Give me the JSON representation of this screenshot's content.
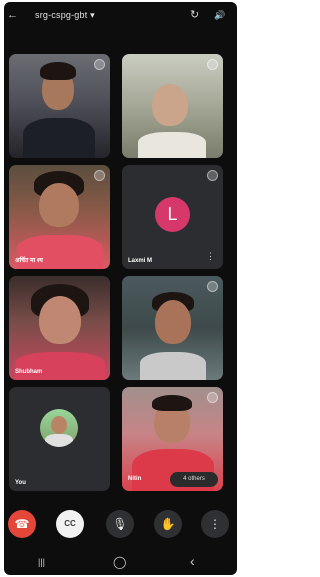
{
  "meeting": {
    "code": "srg-cspg-gbt",
    "chevron": "▾",
    "back_icon": "←",
    "switch_camera_icon": "↻",
    "speaker_icon": "🔊"
  },
  "participants": [
    {
      "name": "",
      "state": "video"
    },
    {
      "name": "",
      "state": "video"
    },
    {
      "name": "अर्चित मा श्य",
      "state": "video"
    },
    {
      "name": "Laxmi M",
      "state": "avatar",
      "initial": "L"
    },
    {
      "name": "Shubham",
      "state": "video"
    },
    {
      "name": "",
      "state": "video"
    },
    {
      "name": "You",
      "state": "avatar-photo"
    },
    {
      "name": "Nitin",
      "state": "video",
      "badge": "4 others"
    }
  ],
  "controls": {
    "end_call_icon": "☎",
    "captions_icon": "CC",
    "mic_icon": "🎙",
    "raise_hand_icon": "✋",
    "more_icon": "⋮"
  },
  "navbar": {
    "recents_icon": "|||",
    "home_icon": "◯",
    "back_icon": "‹"
  },
  "colors": {
    "background": "#0d0d0d",
    "end_call": "#e4473a",
    "avatar_L": "#d6386c",
    "tile_empty": "#2c2d30"
  }
}
